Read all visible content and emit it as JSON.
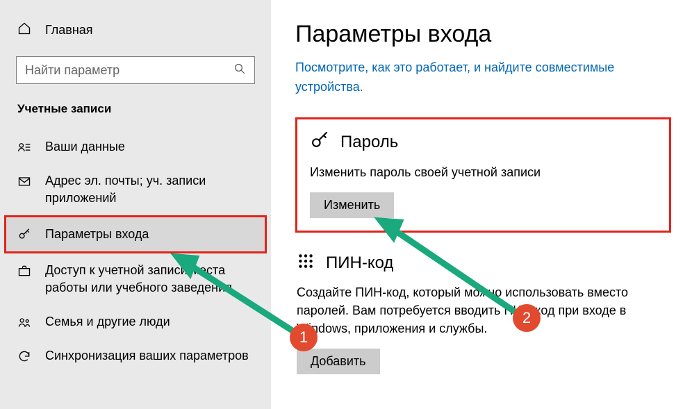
{
  "sidebar": {
    "home_label": "Главная",
    "search_placeholder": "Найти параметр",
    "section_title": "Учетные записи",
    "items": [
      {
        "label": "Ваши данные"
      },
      {
        "label": "Адрес эл. почты; уч. записи приложений"
      },
      {
        "label": "Параметры входа"
      },
      {
        "label": "Доступ к учетной записи места работы или учебного заведения"
      },
      {
        "label": "Семья и другие люди"
      },
      {
        "label": "Синхронизация ваших параметров"
      }
    ]
  },
  "main": {
    "title": "Параметры входа",
    "link": "Посмотрите, как это работает, и найдите совместимые устройства.",
    "password": {
      "title": "Пароль",
      "desc": "Изменить пароль своей учетной записи",
      "button": "Изменить"
    },
    "pin": {
      "title": "ПИН-код",
      "desc": "Создайте ПИН-код, который можно использовать вместо паролей. Вам потребуется вводить ПИН-код при входе в Windows, приложения и службы.",
      "button": "Добавить"
    }
  },
  "annotations": {
    "badge1": "1",
    "badge2": "2"
  }
}
